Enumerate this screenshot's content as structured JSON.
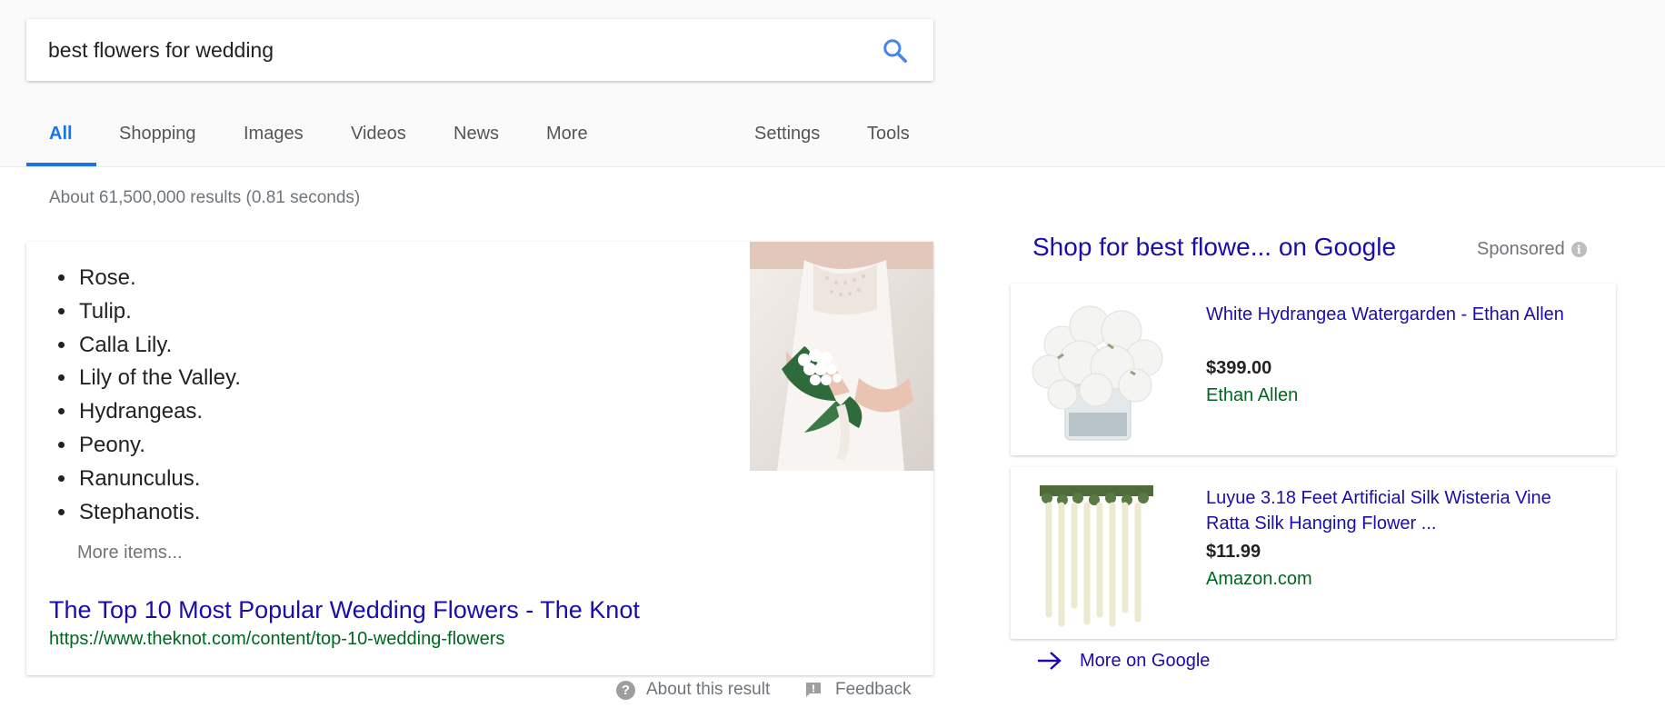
{
  "search": {
    "query": "best flowers for wedding"
  },
  "tabs": [
    {
      "label": "All",
      "active": true
    },
    {
      "label": "Shopping"
    },
    {
      "label": "Images"
    },
    {
      "label": "Videos"
    },
    {
      "label": "News"
    },
    {
      "label": "More"
    },
    {
      "label": "Settings"
    },
    {
      "label": "Tools"
    }
  ],
  "results_stats": "About 61,500,000 results (0.81 seconds)",
  "featured_snippet": {
    "items": [
      "Rose.",
      "Tulip.",
      "Calla Lily.",
      "Lily of the Valley.",
      "Hydrangeas.",
      "Peony.",
      "Ranunculus.",
      "Stephanotis."
    ],
    "more_items": "More items...",
    "link_title": "The Top 10 Most Popular Wedding Flowers - The Knot",
    "url": "https://www.theknot.com/content/top-10-wedding-flowers",
    "about_label": "About this result",
    "feedback_label": "Feedback"
  },
  "shopping": {
    "title": "Shop for best flowe... on Google",
    "sponsored_label": "Sponsored",
    "products": [
      {
        "title": "White Hydrangea Watergarden - Ethan Allen",
        "price": "$399.00",
        "store": "Ethan Allen"
      },
      {
        "title": "Luyue 3.18 Feet Artificial Silk Wisteria Vine Ratta Silk Hanging Flower ...",
        "price": "$11.99",
        "store": "Amazon.com"
      }
    ],
    "more_label": "More on Google"
  },
  "colors": {
    "accent_blue": "#1a73e8",
    "link": "#1a0dab",
    "url_green": "#006621",
    "muted": "#70757a"
  }
}
